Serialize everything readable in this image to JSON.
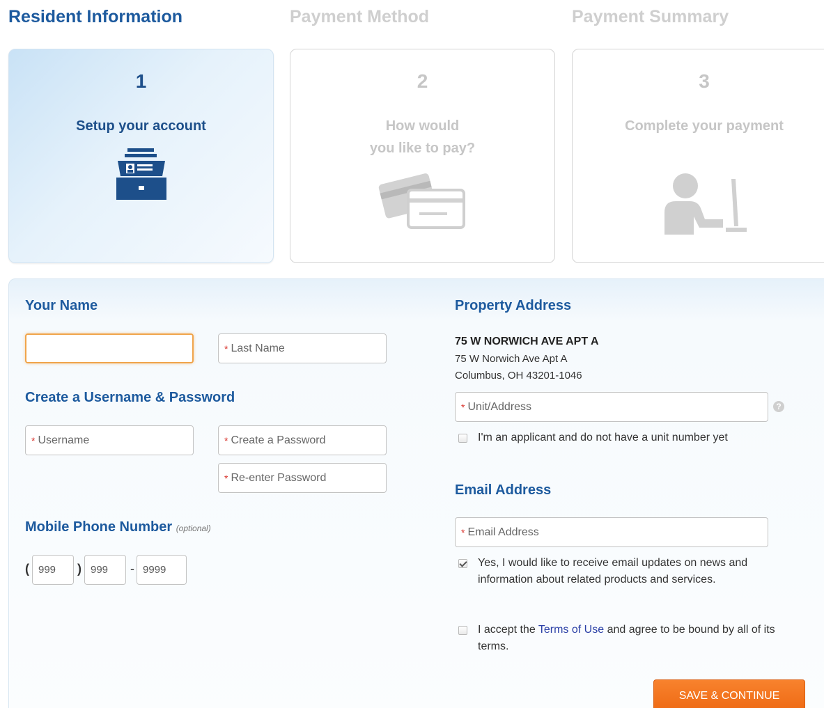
{
  "steps": [
    {
      "title": "Resident Information",
      "number": "1",
      "label": "Setup your account",
      "icon": "file-cabinet-icon"
    },
    {
      "title": "Payment Method",
      "number": "2",
      "label_line1": "How would",
      "label_line2": "you like to pay?",
      "icon": "credit-cards-icon"
    },
    {
      "title": "Payment Summary",
      "number": "3",
      "label": "Complete your payment",
      "icon": "person-at-computer-icon"
    }
  ],
  "form": {
    "your_name": {
      "heading": "Your Name",
      "first_name_value": "",
      "last_name_placeholder": "Last Name"
    },
    "credentials": {
      "heading": "Create a Username & Password",
      "username_placeholder": "Username",
      "password_placeholder": "Create a Password",
      "reenter_placeholder": "Re-enter Password"
    },
    "phone": {
      "heading": "Mobile Phone Number",
      "optional": "(optional)",
      "area": "999",
      "prefix": "999",
      "line": "9999",
      "open_paren": "(",
      "close_paren": ")",
      "dash": "-"
    },
    "property": {
      "heading": "Property Address",
      "address_bold": "75 W NORWICH AVE APT A",
      "address_line1": "75 W Norwich Ave Apt A",
      "address_line2": "Columbus, OH 43201-1046",
      "unit_placeholder": "Unit/Address",
      "help": "?",
      "applicant_label": "I'm an applicant and do not have a unit number yet",
      "applicant_checked": false
    },
    "email": {
      "heading": "Email Address",
      "email_placeholder": "Email Address",
      "updates_line1": "Yes, I would like to receive email updates on news and",
      "updates_line2": "information about related products and services.",
      "updates_checked": true
    },
    "terms": {
      "prefix": "I accept the",
      "link": "Terms of Use",
      "suffix_line1": "and agree to be bound by all of its",
      "suffix_line2": "terms.",
      "checked": false
    },
    "required_marker": "*",
    "save_label": "SAVE & CONTINUE"
  },
  "colors": {
    "primary_blue": "#1d5a9e",
    "inactive_gray": "#cfcfcf",
    "accent_orange": "#f27421",
    "required_red": "#d9322b"
  }
}
